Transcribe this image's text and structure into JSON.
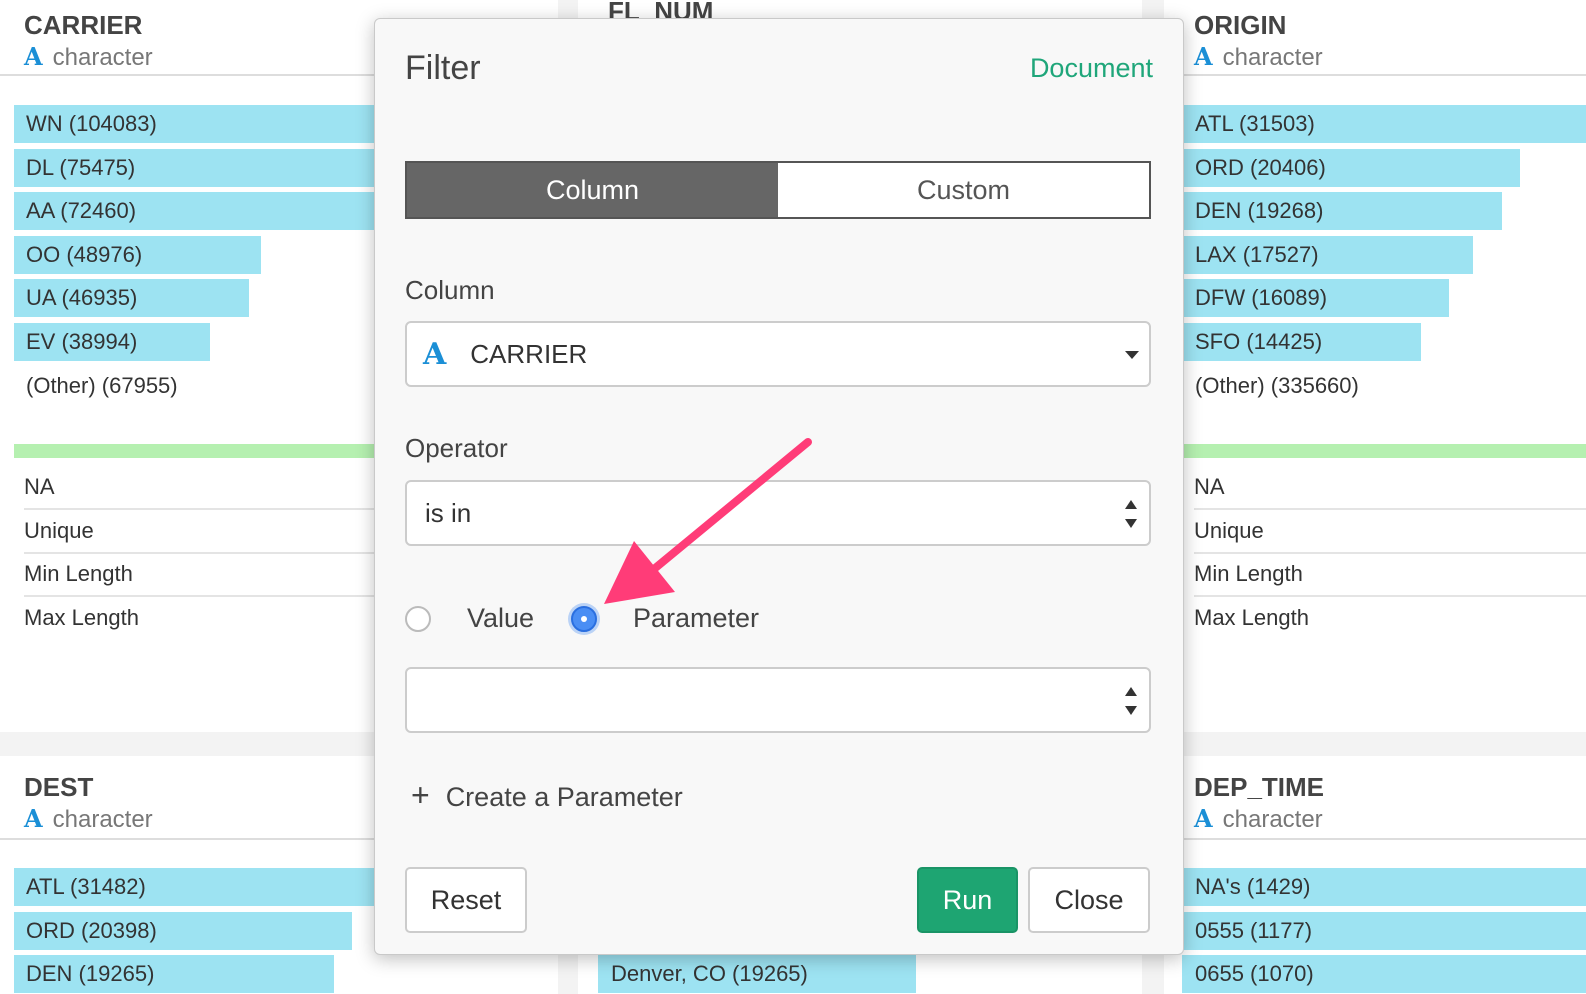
{
  "colors": {
    "accent_green": "#1fa67a",
    "bar_blue": "#9de3f2",
    "bar_green": "#b5f0b0",
    "type_icon": "#1b8fd6",
    "arrow": "#ff3c78"
  },
  "type_icon_glyph": "A",
  "cards": {
    "carrier": {
      "title": "CARRIER",
      "type": "character",
      "bars": [
        {
          "label": "WN (104083)",
          "count": 104083
        },
        {
          "label": "DL (75475)",
          "count": 75475
        },
        {
          "label": "AA (72460)",
          "count": 72460
        },
        {
          "label": "OO (48976)",
          "count": 48976
        },
        {
          "label": "UA (46935)",
          "count": 46935
        },
        {
          "label": "EV (38994)",
          "count": 38994
        }
      ],
      "other": "(Other) (67955)",
      "stats": [
        "NA",
        "Unique",
        "Min Length",
        "Max Length"
      ]
    },
    "fl_num": {
      "title": "FL_NUM",
      "partial_bar_label": "Denver, CO (19265)"
    },
    "origin": {
      "title": "ORIGIN",
      "type": "character",
      "bars": [
        {
          "label": "ATL (31503)",
          "count": 31503
        },
        {
          "label": "ORD (20406)",
          "count": 20406
        },
        {
          "label": "DEN (19268)",
          "count": 19268
        },
        {
          "label": "LAX (17527)",
          "count": 17527
        },
        {
          "label": "DFW (16089)",
          "count": 16089
        },
        {
          "label": "SFO (14425)",
          "count": 14425
        }
      ],
      "other": "(Other) (335660)",
      "stats": [
        "NA",
        "Unique",
        "Min Length",
        "Max Length"
      ]
    },
    "dest": {
      "title": "DEST",
      "type": "character",
      "bars": [
        {
          "label": "ATL (31482)",
          "count": 31482
        },
        {
          "label": "ORD (20398)",
          "count": 20398
        },
        {
          "label": "DEN (19265)",
          "count": 19265
        }
      ]
    },
    "dep_time": {
      "title": "DEP_TIME",
      "type": "character",
      "bars": [
        {
          "label": "NA's (1429)",
          "count": 1429
        },
        {
          "label": "0555 (1177)",
          "count": 1177
        },
        {
          "label": "0655 (1070)",
          "count": 1070
        }
      ]
    }
  },
  "modal": {
    "title": "Filter",
    "document_link": "Document",
    "tabs": [
      {
        "label": "Column",
        "active": true
      },
      {
        "label": "Custom",
        "active": false
      }
    ],
    "column_label": "Column",
    "column_value": "CARRIER",
    "operator_label": "Operator",
    "operator_value": "is in",
    "radio_value_label": "Value",
    "radio_parameter_label": "Parameter",
    "selected_radio": "Parameter",
    "parameter_select_value": "",
    "create_parameter_label": "Create a Parameter",
    "buttons": {
      "reset": "Reset",
      "run": "Run",
      "close": "Close"
    }
  }
}
